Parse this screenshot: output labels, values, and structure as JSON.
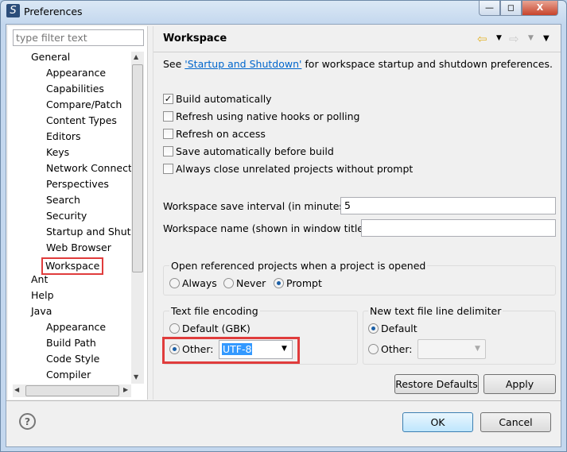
{
  "window": {
    "title": "Preferences",
    "minimize": "—",
    "maximize": "◻",
    "close": "X"
  },
  "filter": {
    "placeholder": "type filter text"
  },
  "tree": [
    {
      "label": "General",
      "level": 0
    },
    {
      "label": "Appearance",
      "level": 1
    },
    {
      "label": "Capabilities",
      "level": 1
    },
    {
      "label": "Compare/Patch",
      "level": 1
    },
    {
      "label": "Content Types",
      "level": 1
    },
    {
      "label": "Editors",
      "level": 1
    },
    {
      "label": "Keys",
      "level": 1
    },
    {
      "label": "Network Connections",
      "level": 1
    },
    {
      "label": "Perspectives",
      "level": 1
    },
    {
      "label": "Search",
      "level": 1
    },
    {
      "label": "Security",
      "level": 1
    },
    {
      "label": "Startup and Shutdown",
      "level": 1
    },
    {
      "label": "Web Browser",
      "level": 1
    },
    {
      "label": "Workspace",
      "level": 1,
      "selected": true
    },
    {
      "label": "Ant",
      "level": 0
    },
    {
      "label": "Help",
      "level": 0
    },
    {
      "label": "Java",
      "level": 0
    },
    {
      "label": "Appearance",
      "level": 1
    },
    {
      "label": "Build Path",
      "level": 1
    },
    {
      "label": "Code Style",
      "level": 1
    },
    {
      "label": "Compiler",
      "level": 1
    }
  ],
  "page": {
    "title": "Workspace",
    "intro_prefix": "See ",
    "intro_link": "'Startup and Shutdown'",
    "intro_suffix": " for workspace startup and shutdown preferences.",
    "checkboxes": [
      {
        "label": "Build automatically",
        "checked": true
      },
      {
        "label": "Refresh using native hooks or polling",
        "checked": false
      },
      {
        "label": "Refresh on access",
        "checked": false
      },
      {
        "label": "Save automatically before build",
        "checked": false
      },
      {
        "label": "Always close unrelated projects without prompt",
        "checked": false
      }
    ],
    "save_interval_label": "Workspace save interval (in minutes):",
    "save_interval_value": "5",
    "name_label": "Workspace name (shown in window title):",
    "name_value": "",
    "open_ref": {
      "title": "Open referenced projects when a project is opened",
      "options": [
        "Always",
        "Never",
        "Prompt"
      ],
      "selected": "Prompt"
    },
    "encoding": {
      "title": "Text file encoding",
      "default_label": "Default (GBK)",
      "other_label": "Other:",
      "other_value": "UTF-8",
      "selected": "Other"
    },
    "delimiter": {
      "title": "New text file line delimiter",
      "default_label": "Default",
      "other_label": "Other:",
      "other_value": "",
      "selected": "Default"
    },
    "restore_label": "Restore Defaults",
    "apply_label": "Apply"
  },
  "footer": {
    "help": "?",
    "ok": "OK",
    "cancel": "Cancel"
  },
  "colors": {
    "highlight": "#e03c3c",
    "link": "#0066cc",
    "selection": "#3399ff"
  }
}
